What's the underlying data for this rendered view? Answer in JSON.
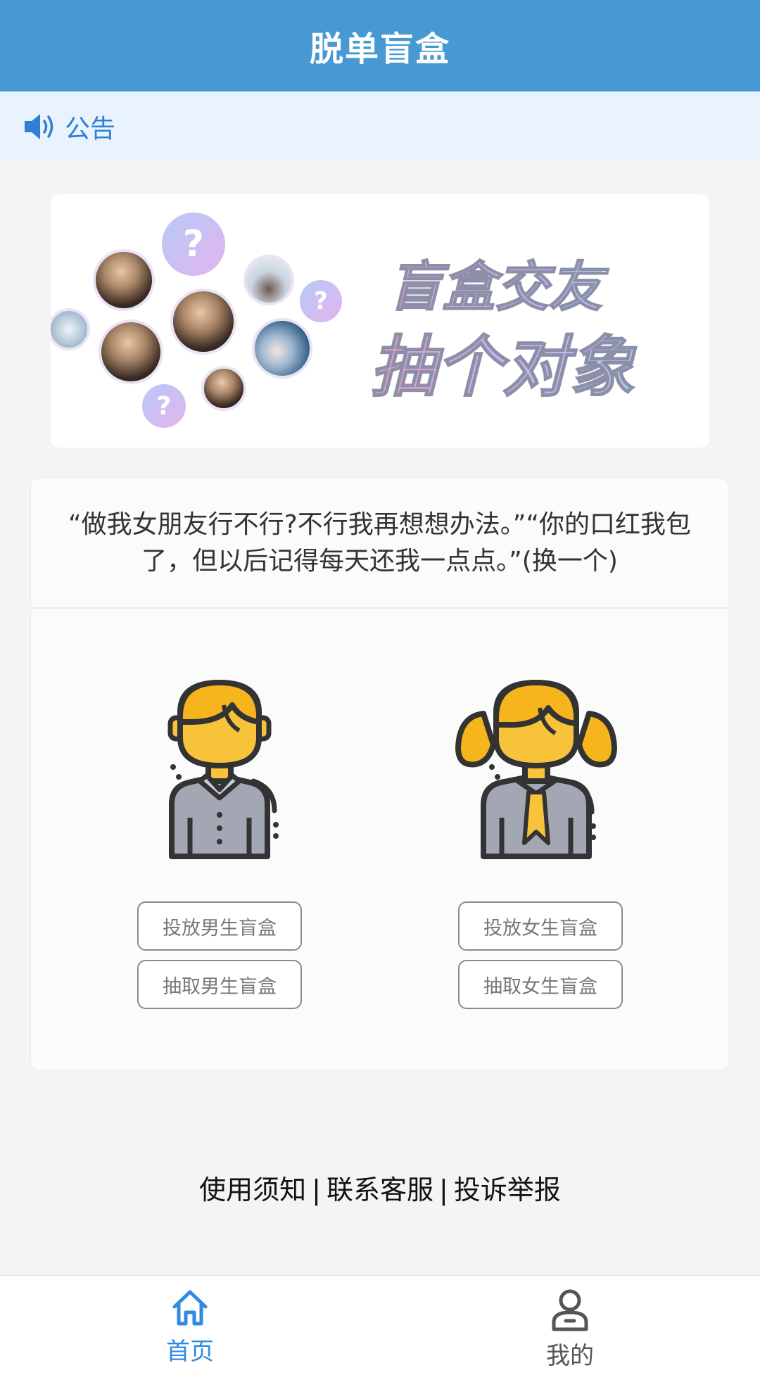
{
  "header": {
    "title": "脱单盲盒"
  },
  "notice": {
    "label": "公告",
    "icon": "speaker-icon",
    "accent": "#2f7fd6"
  },
  "banner": {
    "slogan_line1": "盲盒交友",
    "slogan_line2": "抽个对象",
    "question_mark": "?"
  },
  "quote": {
    "text": "“做我女朋友行不行?不行我再想想办法。”“你的口红我包了，但以后记得每天还我一点点。”",
    "swap_label": "(换一个)"
  },
  "male": {
    "icon": "male-avatar-icon",
    "put_label": "投放男生盲盒",
    "draw_label": "抽取男生盲盒"
  },
  "female": {
    "icon": "female-avatar-icon",
    "put_label": "投放女生盲盒",
    "draw_label": "抽取女生盲盒"
  },
  "footer": {
    "links": [
      "使用须知",
      "联系客服",
      "投诉举报"
    ],
    "separator": "|"
  },
  "tabbar": {
    "tabs": [
      {
        "label": "首页",
        "icon": "home-icon",
        "active": true
      },
      {
        "label": "我的",
        "icon": "user-icon",
        "active": false
      }
    ],
    "active_color": "#2f8ae0"
  },
  "colors": {
    "header_bg": "#4799d3",
    "notice_bg": "#e9f3fe",
    "page_bg": "#f4f4f4"
  }
}
